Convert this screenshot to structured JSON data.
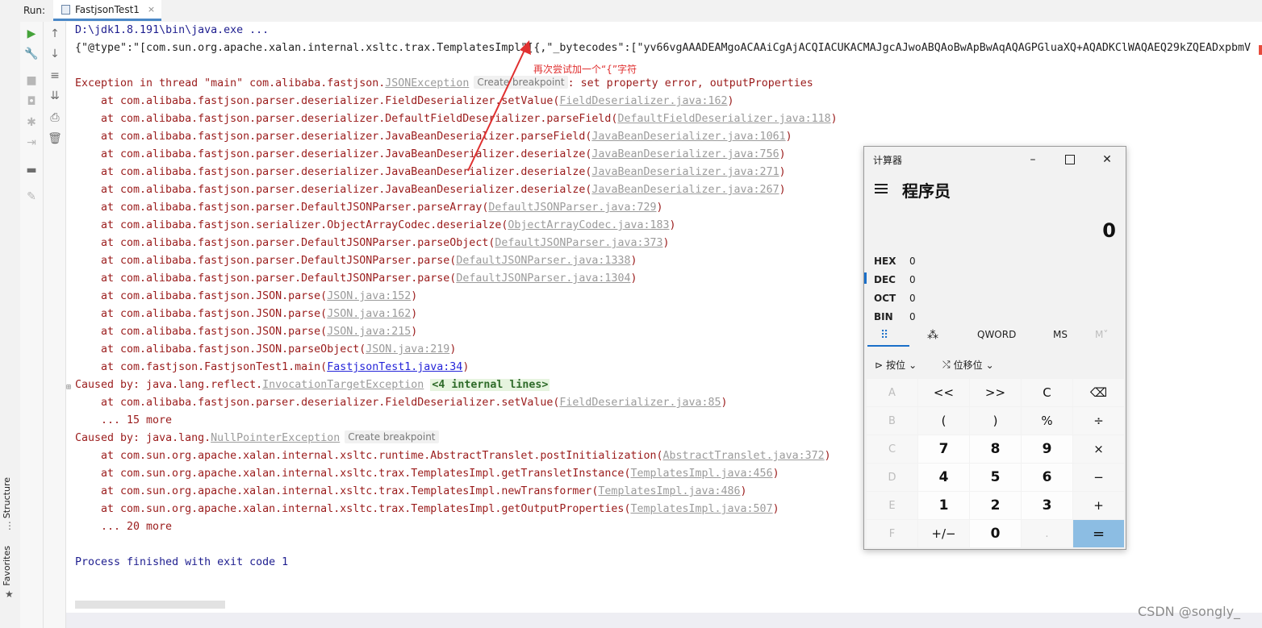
{
  "run_panel": {
    "label": "Run:",
    "tab_title": "FastjsonTest1",
    "close_glyph": "×"
  },
  "left_strip": {
    "structure": "Structure",
    "favorites": "Favorites"
  },
  "console": {
    "cmd": "D:\\jdk1.8.191\\bin\\java.exe ...",
    "json": "{\"@type\":\"[com.sun.org.apache.xalan.internal.xsltc.trax.TemplatesImpl\"[{,\"_bytecodes\":[\"yv66vgAAADEAMgoACAAiCgAjACQIACUKACMAJgcAJwoABQAoBwApBwAqAQAGPGluaXQ+AQADKClWAQAEQ29kZQEADxpbmV",
    "exception": {
      "prefix": "Exception in thread \"main\" com.alibaba.fastjson.",
      "link": "JSONException",
      "hint": "Create breakpoint",
      "suffix": ": set property error, outputProperties"
    },
    "frames1": [
      {
        "method": "at com.alibaba.fastjson.parser.deserializer.FieldDeserializer.setValue(",
        "file": "FieldDeserializer.java:162"
      },
      {
        "method": "at com.alibaba.fastjson.parser.deserializer.DefaultFieldDeserializer.parseField(",
        "file": "DefaultFieldDeserializer.java:118"
      },
      {
        "method": "at com.alibaba.fastjson.parser.deserializer.JavaBeanDeserializer.parseField(",
        "file": "JavaBeanDeserializer.java:1061"
      },
      {
        "method": "at com.alibaba.fastjson.parser.deserializer.JavaBeanDeserializer.deserialze(",
        "file": "JavaBeanDeserializer.java:756"
      },
      {
        "method": "at com.alibaba.fastjson.parser.deserializer.JavaBeanDeserializer.deserialze(",
        "file": "JavaBeanDeserializer.java:271"
      },
      {
        "method": "at com.alibaba.fastjson.parser.deserializer.JavaBeanDeserializer.deserialze(",
        "file": "JavaBeanDeserializer.java:267"
      },
      {
        "method": "at com.alibaba.fastjson.parser.DefaultJSONParser.parseArray(",
        "file": "DefaultJSONParser.java:729"
      },
      {
        "method": "at com.alibaba.fastjson.serializer.ObjectArrayCodec.deserialze(",
        "file": "ObjectArrayCodec.java:183"
      },
      {
        "method": "at com.alibaba.fastjson.parser.DefaultJSONParser.parseObject(",
        "file": "DefaultJSONParser.java:373"
      },
      {
        "method": "at com.alibaba.fastjson.parser.DefaultJSONParser.parse(",
        "file": "DefaultJSONParser.java:1338"
      },
      {
        "method": "at com.alibaba.fastjson.parser.DefaultJSONParser.parse(",
        "file": "DefaultJSONParser.java:1304"
      },
      {
        "method": "at com.alibaba.fastjson.JSON.parse(",
        "file": "JSON.java:152"
      },
      {
        "method": "at com.alibaba.fastjson.JSON.parse(",
        "file": "JSON.java:162"
      },
      {
        "method": "at com.alibaba.fastjson.JSON.parse(",
        "file": "JSON.java:215"
      },
      {
        "method": "at com.alibaba.fastjson.JSON.parseObject(",
        "file": "JSON.java:219"
      }
    ],
    "main_frame": {
      "method": "at com.fastjson.FastjsonTest1.main(",
      "file": "FastjsonTest1.java:34"
    },
    "caused1": {
      "prefix": "Caused by: java.lang.reflect.",
      "link": "InvocationTargetException",
      "internal": "<4 internal lines>"
    },
    "caused1_frame": {
      "method": "at com.alibaba.fastjson.parser.deserializer.FieldDeserializer.setValue(",
      "file": "FieldDeserializer.java:85"
    },
    "more1": "... 15 more",
    "caused2": {
      "prefix": "Caused by: java.lang.",
      "link": "NullPointerException",
      "hint": "Create breakpoint"
    },
    "frames2": [
      {
        "method": "at com.sun.org.apache.xalan.internal.xsltc.runtime.AbstractTranslet.postInitialization(",
        "file": "AbstractTranslet.java:372"
      },
      {
        "method": "at com.sun.org.apache.xalan.internal.xsltc.trax.TemplatesImpl.getTransletInstance(",
        "file": "TemplatesImpl.java:456"
      },
      {
        "method": "at com.sun.org.apache.xalan.internal.xsltc.trax.TemplatesImpl.newTransformer(",
        "file": "TemplatesImpl.java:486"
      },
      {
        "method": "at com.sun.org.apache.xalan.internal.xsltc.trax.TemplatesImpl.getOutputProperties(",
        "file": "TemplatesImpl.java:507"
      }
    ],
    "more2": "... 20 more",
    "process": "Process finished with exit code 1",
    "close_paren": ")"
  },
  "annotation": "再次尝试加一个“{”字符",
  "watermark": "CSDN @songly_",
  "calculator": {
    "window_title": "计算器",
    "mode": "程序员",
    "display_value": "0",
    "radix": [
      {
        "name": "HEX",
        "value": "0"
      },
      {
        "name": "DEC",
        "value": "0"
      },
      {
        "name": "OCT",
        "value": "0"
      },
      {
        "name": "BIN",
        "value": "0"
      }
    ],
    "selected_radix": "DEC",
    "tabs": [
      "QWORD",
      "MS",
      "M˅"
    ],
    "bitwise_label": "按位",
    "bitshift_label": "位移位",
    "keys": [
      [
        "A",
        "<<",
        ">>",
        "C",
        "⌫"
      ],
      [
        "B",
        "(",
        ")",
        "%",
        "÷"
      ],
      [
        "C",
        "7",
        "8",
        "9",
        "×"
      ],
      [
        "D",
        "4",
        "5",
        "6",
        "−"
      ],
      [
        "E",
        "1",
        "2",
        "3",
        "+"
      ],
      [
        "F",
        "+/−",
        "0",
        ".",
        "="
      ]
    ],
    "colors": {
      "accent": "#1a6fc9",
      "equals": "#8cbde3"
    }
  },
  "colors": {
    "error_text": "#9a1b1b",
    "command_text": "#1e1e8f",
    "annotation": "#e03030"
  }
}
